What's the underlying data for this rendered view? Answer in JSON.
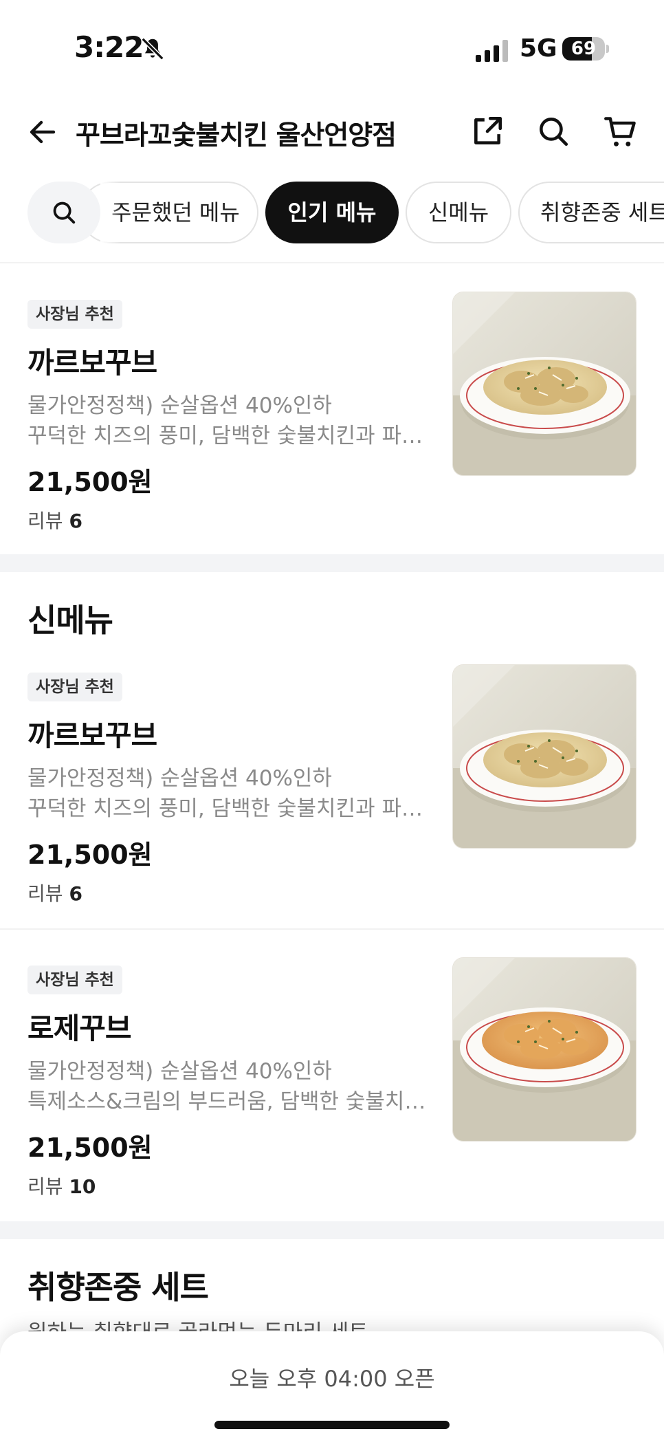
{
  "status_bar": {
    "time": "3:22",
    "network": "5G",
    "battery": "69",
    "battery_level": 0.69
  },
  "header": {
    "title": "꾸브라꼬숯불치킨 울산언양점",
    "back_icon": "arrow-left-icon",
    "share_icon": "share-icon",
    "search_icon": "search-icon",
    "cart_icon": "cart-icon"
  },
  "tabs": [
    {
      "label": "주문했던 메뉴",
      "active": false
    },
    {
      "label": "인기 메뉴",
      "active": true
    },
    {
      "label": "신메뉴",
      "active": false
    },
    {
      "label": "취향존중 세트",
      "active": false
    }
  ],
  "popular": {
    "items": [
      {
        "badge": "사장님 추천",
        "name": "까르보꾸브",
        "desc1": "물가안정정책) 순살옵션 40%인하",
        "desc2": "꾸덕한 치즈의 풍미, 담백한 숯불치킨과 파…",
        "price": "21,500원",
        "review_label": "리뷰",
        "review_count": "6"
      }
    ]
  },
  "new_menu": {
    "title": "신메뉴",
    "items": [
      {
        "badge": "사장님 추천",
        "name": "까르보꾸브",
        "desc1": "물가안정정책) 순살옵션 40%인하",
        "desc2": "꾸덕한 치즈의 풍미, 담백한 숯불치킨과 파…",
        "price": "21,500원",
        "review_label": "리뷰",
        "review_count": "6"
      },
      {
        "badge": "사장님 추천",
        "name": "로제꾸브",
        "desc1": "물가안정정책) 순살옵션 40%인하",
        "desc2": "특제소스&크림의 부드러움, 담백한 숯불치…",
        "price": "21,500원",
        "review_label": "리뷰",
        "review_count": "10"
      }
    ]
  },
  "set_section": {
    "title": "취향존중 세트",
    "subtitle": "원하는 취향대로 골라먹는 두마리 세트"
  },
  "bottom_bar": {
    "label": "오늘 오후 04:00 오픈"
  }
}
